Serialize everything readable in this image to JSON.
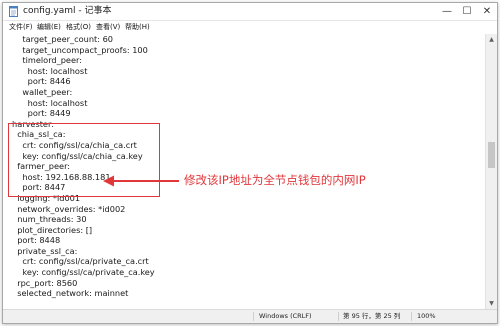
{
  "window": {
    "title": "config.yaml - 记事本",
    "minimize_symbol": "—",
    "maximize_symbol": "☐",
    "close_symbol": "✕"
  },
  "menu": [
    "文件(F)",
    "编辑(E)",
    "格式(O)",
    "查看(V)",
    "帮助(H)"
  ],
  "editor": {
    "lines": [
      "    target_peer_count: 60",
      "    target_uncompact_proofs: 100",
      "    timelord_peer:",
      "      host: localhost",
      "      port: 8446",
      "    wallet_peer:",
      "      host: localhost",
      "      port: 8449",
      "harvester:",
      "  chia_ssl_ca:",
      "    crt: config/ssl/ca/chia_ca.crt",
      "    key: config/ssl/ca/chia_ca.key",
      "  farmer_peer:",
      "    host: 192.168.88.181",
      "    port: 8447",
      "  logging: *id001",
      "  network_overrides: *id002",
      "  num_threads: 30",
      "  plot_directories: []",
      "  port: 8448",
      "  private_ssl_ca:",
      "    crt: config/ssl/ca/private_ca.crt",
      "    key: config/ssl/ca/private_ca.key",
      "  rpc_port: 8560",
      "  selected_network: mainnet"
    ]
  },
  "annotation": {
    "text": "修改该IP地址为全节点钱包的内网IP",
    "color": "#e0373b"
  },
  "statusbar": {
    "line_ending": "Windows (CRLF)",
    "position": "第 95 行，第 25 列",
    "zoom": "100%"
  },
  "icons": {
    "app": "notepad-icon",
    "scroll_up": "▲",
    "scroll_down": "▼"
  }
}
